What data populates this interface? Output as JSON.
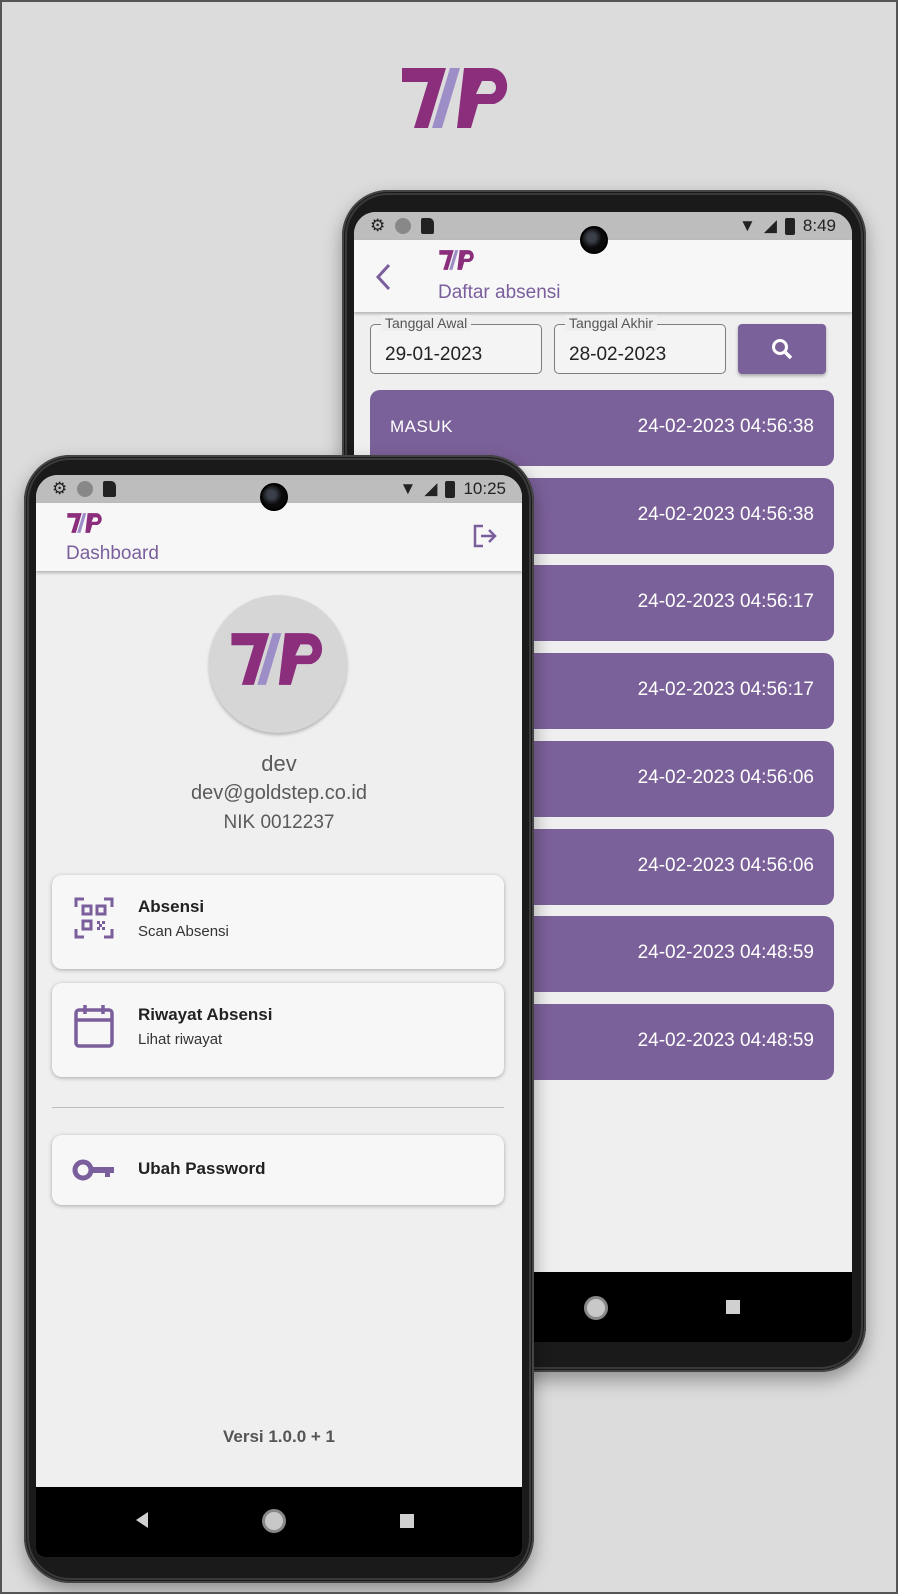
{
  "colors": {
    "brand_purple": "#8b2e7c",
    "brand_lilac": "#9e8ec8",
    "accent": "#7b6199",
    "statusbar": "#bdbdbd"
  },
  "back_phone": {
    "status_time": "8:49",
    "appbar": {
      "title": "Daftar absensi",
      "back_icon": "chevron-left-icon"
    },
    "filters": {
      "start_label": "Tanggal Awal",
      "start_value": "29-01-2023",
      "end_label": "Tanggal Akhir",
      "end_value": "28-02-2023",
      "search_icon": "search-icon"
    },
    "attendance": [
      {
        "type": "MASUK",
        "time": "24-02-2023 04:56:38"
      },
      {
        "type": "",
        "time": "24-02-2023 04:56:38"
      },
      {
        "type": "",
        "time": "24-02-2023 04:56:17"
      },
      {
        "type": "",
        "time": "24-02-2023 04:56:17"
      },
      {
        "type": "",
        "time": "24-02-2023 04:56:06"
      },
      {
        "type": "",
        "time": "24-02-2023 04:56:06"
      },
      {
        "type": "",
        "time": "24-02-2023 04:48:59"
      },
      {
        "type": "",
        "time": "24-02-2023 04:48:59"
      }
    ]
  },
  "front_phone": {
    "status_time": "10:25",
    "appbar": {
      "title": "Dashboard",
      "logout_icon": "logout-icon"
    },
    "profile": {
      "name": "dev",
      "email": "dev@goldstep.co.id",
      "nik": "NIK 0012237"
    },
    "menu": [
      {
        "title": "Absensi",
        "subtitle": "Scan Absensi",
        "icon": "qr-scan-icon"
      },
      {
        "title": "Riwayat Absensi",
        "subtitle": "Lihat riwayat",
        "icon": "calendar-icon"
      },
      {
        "title": "Ubah Password",
        "subtitle": "",
        "icon": "key-icon"
      }
    ],
    "version": "Versi 1.0.0 + 1"
  }
}
